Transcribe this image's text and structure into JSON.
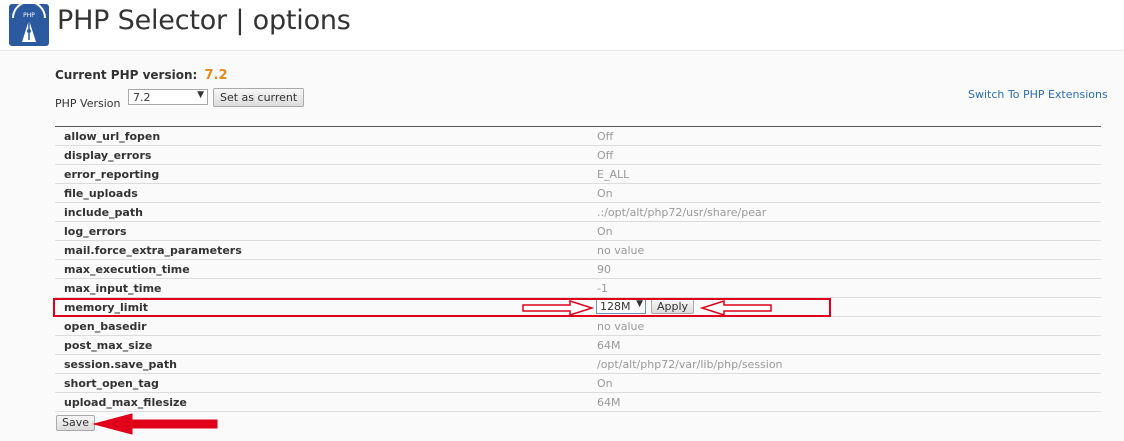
{
  "header": {
    "title": "PHP Selector | options",
    "logo_icon": "php-selector-logo-icon"
  },
  "version": {
    "current_label": "Current PHP version:",
    "current_value": "7.2",
    "php_version_label": "PHP Version",
    "selected": "7.2",
    "set_current_label": "Set as current",
    "switch_link": "Switch To PHP Extensions"
  },
  "options": [
    {
      "name": "allow_url_fopen",
      "value": "Off"
    },
    {
      "name": "display_errors",
      "value": "Off"
    },
    {
      "name": "error_reporting",
      "value": "E_ALL"
    },
    {
      "name": "file_uploads",
      "value": "On"
    },
    {
      "name": "include_path",
      "value": ".:/opt/alt/php72/usr/share/pear"
    },
    {
      "name": "log_errors",
      "value": "On"
    },
    {
      "name": "mail.force_extra_parameters",
      "value": "no value"
    },
    {
      "name": "max_execution_time",
      "value": "90"
    },
    {
      "name": "max_input_time",
      "value": "-1"
    },
    {
      "name": "memory_limit",
      "value": "128M",
      "editing": true,
      "apply_label": "Apply"
    },
    {
      "name": "open_basedir",
      "value": "no value"
    },
    {
      "name": "post_max_size",
      "value": "64M"
    },
    {
      "name": "session.save_path",
      "value": "/opt/alt/php72/var/lib/php/session"
    },
    {
      "name": "short_open_tag",
      "value": "On"
    },
    {
      "name": "upload_max_filesize",
      "value": "64M"
    }
  ],
  "save_label": "Save",
  "colors": {
    "annotation_red": "#e0001a",
    "version_orange": "#e58a1f",
    "link_blue": "#2a6fb0"
  }
}
